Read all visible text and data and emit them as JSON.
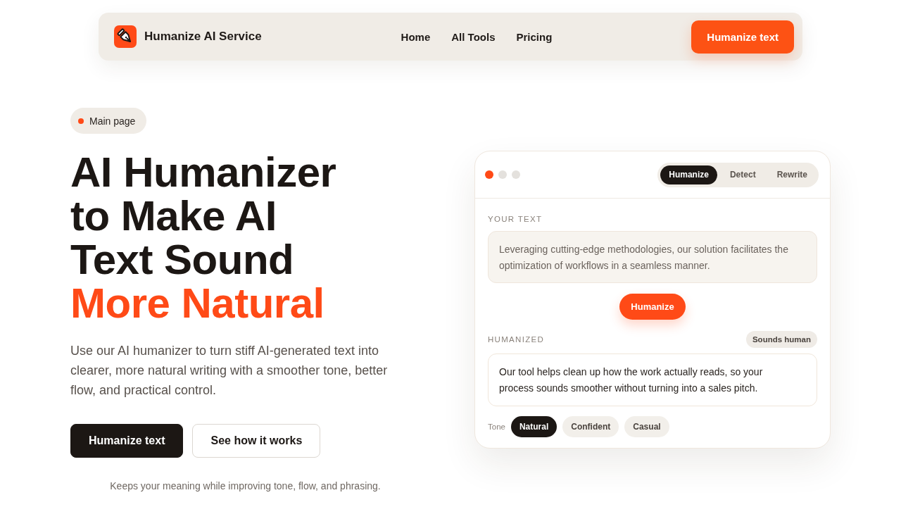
{
  "nav": {
    "brand": "Humanize AI Service",
    "links": [
      {
        "label": "Home"
      },
      {
        "label": "All Tools"
      },
      {
        "label": "Pricing"
      }
    ],
    "cta": "Humanize text"
  },
  "hero": {
    "badge": "Main page",
    "title": [
      {
        "text": "AI Humanizer",
        "accent": false
      },
      {
        "text": "to Make AI",
        "accent": false
      },
      {
        "text": "Text Sound",
        "accent": false
      },
      {
        "text": "More Natural",
        "accent": true
      }
    ],
    "description": "Use our AI humanizer to turn stiff AI-generated text into clearer, more natural writing with a smoother tone, better flow, and practical control.",
    "buttons": [
      {
        "label": "Humanize text",
        "kind": "primary"
      },
      {
        "label": "See how it works",
        "kind": "secondary"
      }
    ],
    "note": "Keeps your meaning while improving tone, flow, and phrasing."
  },
  "demo": {
    "window_dots": [
      {
        "color": "#ff4a17"
      },
      {
        "color": "#e4e1dd"
      },
      {
        "color": "#e4e1dd"
      }
    ],
    "tabs": [
      {
        "label": "Humanize",
        "selected": true
      },
      {
        "label": "Detect",
        "selected": false
      },
      {
        "label": "Rewrite",
        "selected": false
      }
    ],
    "input_label": "YOUR TEXT",
    "input_text": "Leveraging cutting-edge methodologies, our solution facilitates the optimization of workflows in a seamless manner.",
    "action": "Humanize",
    "output_label": "HUMANIZED",
    "output_badge": "Sounds human",
    "output_text": "Our tool helps clean up how the work actually reads, so your process sounds smoother without turning into a sales pitch.",
    "tone_label": "Tone",
    "tones": [
      {
        "label": "Natural",
        "selected": true
      },
      {
        "label": "Confident",
        "selected": false
      },
      {
        "label": "Casual",
        "selected": false
      }
    ]
  }
}
